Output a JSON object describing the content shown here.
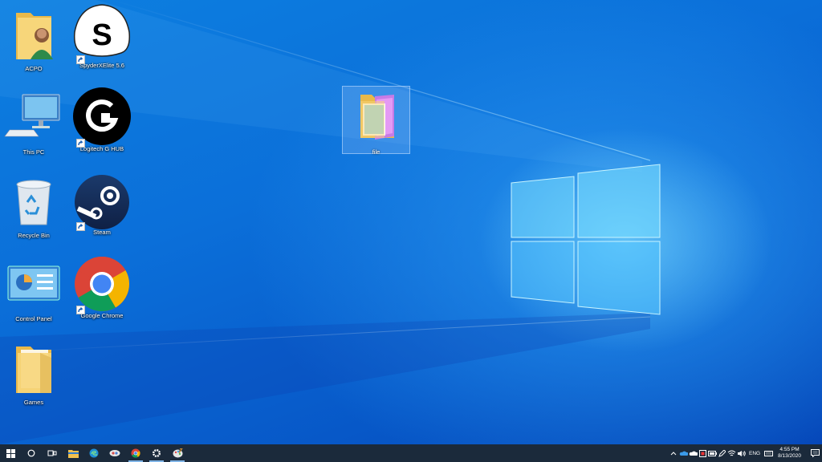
{
  "desktop": {
    "icons": [
      {
        "label": "ACPO"
      },
      {
        "label": "This PC"
      },
      {
        "label": "Recycle Bin"
      },
      {
        "label": "Control Panel"
      },
      {
        "label": "Games"
      },
      {
        "label": "SpyderXElite 5.6"
      },
      {
        "label": "Logitech G HUB"
      },
      {
        "label": "Steam"
      },
      {
        "label": "Google Chrome"
      }
    ],
    "selected_item": {
      "label": "file"
    }
  },
  "taskbar": {
    "tray": {
      "language": "ENG",
      "time": "4:55 PM",
      "date": "8/13/2020"
    }
  },
  "colors": {
    "taskbar_bg": "#1b2a3b",
    "desktop_blue": "#0b6fd9"
  }
}
